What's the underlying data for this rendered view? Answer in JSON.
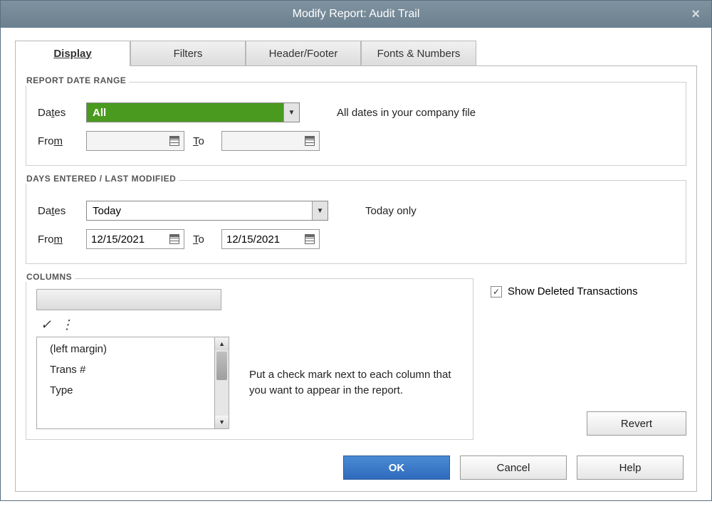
{
  "window": {
    "title": "Modify Report: Audit Trail"
  },
  "tabs": {
    "display": "Display",
    "filters": "Filters",
    "header_footer": "Header/Footer",
    "fonts_numbers": "Fonts & Numbers"
  },
  "report_date_range": {
    "legend": "REPORT DATE RANGE",
    "dates_label": "Dates",
    "dates_value": "All",
    "dates_hint": "All dates in your company file",
    "from_label": "From",
    "to_label": "To",
    "from_value": "",
    "to_value": ""
  },
  "days_modified": {
    "legend": "DAYS ENTERED / LAST MODIFIED",
    "dates_label": "Dates",
    "dates_value": "Today",
    "dates_hint": "Today only",
    "from_label": "From",
    "to_label": "To",
    "from_value": "12/15/2021",
    "to_value": "12/15/2021"
  },
  "columns": {
    "legend": "COLUMNS",
    "items": [
      "(left margin)",
      "Trans #",
      "Type"
    ],
    "help_text": "Put a check mark next to each column that you want to appear in the report."
  },
  "show_deleted": {
    "label": "Show Deleted Transactions",
    "checked": true
  },
  "buttons": {
    "revert": "Revert",
    "ok": "OK",
    "cancel": "Cancel",
    "help": "Help"
  }
}
